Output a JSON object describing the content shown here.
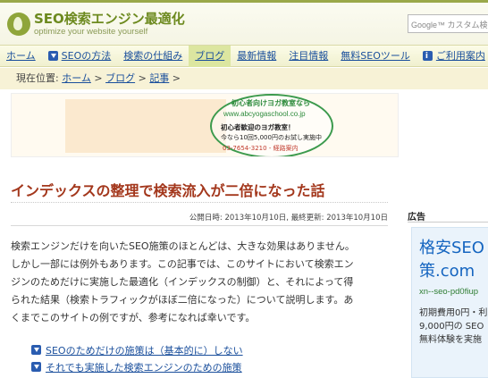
{
  "header": {
    "logo_title": "SEO検索エンジン最適化",
    "logo_tagline": "optimize your website yourself",
    "search_placeholder": "Google™ カスタム検索"
  },
  "nav": {
    "items": [
      {
        "label": "ホーム",
        "icon": ""
      },
      {
        "label": "SEOの方法",
        "icon": "arrow-down-icon"
      },
      {
        "label": "検索の仕組み",
        "icon": ""
      },
      {
        "label": "ブログ",
        "icon": "",
        "active": true
      },
      {
        "label": "最新情報",
        "icon": ""
      },
      {
        "label": "注目情報",
        "icon": ""
      },
      {
        "label": "無料SEOツール",
        "icon": ""
      },
      {
        "label": "ご利用案内",
        "icon": "info-icon"
      }
    ]
  },
  "breadcrumb": {
    "prefix": "現在位置: ",
    "items": [
      "ホーム",
      "ブログ",
      "記事"
    ],
    "separator": " > "
  },
  "banner": {
    "line1": "初心者向けヨガ教室なら",
    "line2": "www.abcyogaschool.co.jp",
    "line3": "初心者歓迎のヨガ教室！",
    "line4": "今なら10回5,000円のお試し実施中",
    "line5": "03-7654-3210 - 経路案内"
  },
  "article": {
    "title": "インデックスの整理で検索流入が二倍になった話",
    "meta": "公開日時: 2013年10月10日, 最終更新: 2013年10月10日",
    "body_lines": [
      "検索エンジンだけを向いたSEO施策のほとんどは、大きな効果はありません。",
      "しかし一部には例外もあります。この記事では、このサイトにおいて検索エン",
      "ジンのためだけに実施した最適化（インデックスの制御）と、それによって得",
      "られた結果（検索トラフィックがほぼ二倍になった）について説明します。あ",
      "くまでこのサイトの例ですが、参考になれば幸いです。"
    ],
    "toc": [
      "SEOのためだけの施策は（基本的に）しない",
      "それでも実施した検索エンジンのための施策"
    ]
  },
  "sidebar": {
    "ad_label": "広告",
    "ad_title_line1": "格安SEO",
    "ad_title_line2": "策.com",
    "ad_url": "xn--seo-pd0fiup",
    "ad_desc_lines": [
      "初期費用0円・利",
      "9,000円の SEO",
      "無料体験を実施"
    ]
  },
  "colors": {
    "accent_green": "#6d8a1f",
    "link_blue": "#1a4f9c",
    "title_red": "#a3371c",
    "ad_blue": "#1565c0"
  }
}
